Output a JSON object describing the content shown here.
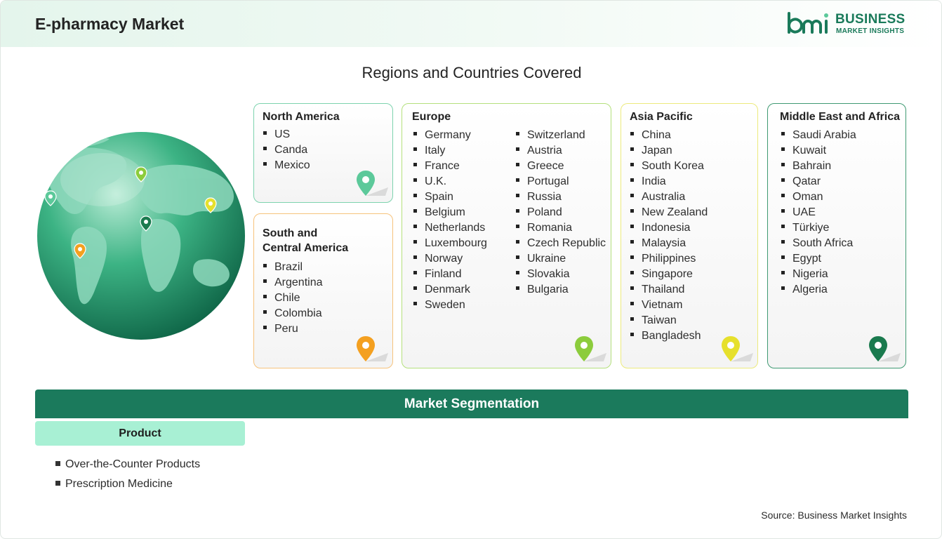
{
  "header": {
    "title": "E-pharmacy Market"
  },
  "logo": {
    "line1": "BUSINESS",
    "line2": "MARKET INSIGHTS",
    "color": "#1a7a5a"
  },
  "section": {
    "title": "Regions and Countries Covered"
  },
  "regions": {
    "north_america": {
      "title": "North America",
      "countries": [
        "US",
        "Canda",
        "Mexico"
      ],
      "color": "#5cc99a"
    },
    "south_central_america": {
      "title_line1": "South and",
      "title_line2": "Central America",
      "countries": [
        "Brazil",
        "Argentina",
        "Chile",
        "Colombia",
        "Peru"
      ],
      "color": "#f4a020"
    },
    "europe": {
      "title": "Europe",
      "countries_col1": [
        "Germany",
        "Italy",
        "France",
        "U.K.",
        "Spain",
        "Belgium",
        "Netherlands",
        "Luxembourg",
        "Norway",
        "Finland",
        "Denmark",
        "Sweden"
      ],
      "countries_col2": [
        "Switzerland",
        "Austria",
        "Greece",
        "Portugal",
        "Russia",
        "Poland",
        "Romania",
        "Czech Republic",
        "Ukraine",
        "Slovakia",
        "Bulgaria"
      ],
      "color": "#8ccc3c"
    },
    "asia_pacific": {
      "title": "Asia Pacific",
      "countries": [
        "China",
        "Japan",
        "South Korea",
        "India",
        "Australia",
        "New Zealand",
        "Indonesia",
        "Malaysia",
        "Philippines",
        "Singapore",
        "Thailand",
        "Vietnam",
        "Taiwan",
        "Bangladesh"
      ],
      "color": "#e6e02c"
    },
    "middle_east_africa": {
      "title": "Middle East and Africa",
      "countries": [
        "Saudi Arabia",
        "Kuwait",
        "Bahrain",
        "Qatar",
        "Oman",
        "UAE",
        "Türkiye",
        "South Africa",
        "Egypt",
        "Nigeria",
        "Algeria"
      ],
      "color": "#1a7a4e"
    }
  },
  "segmentation": {
    "title": "Market Segmentation",
    "product": {
      "label": "Product",
      "items": [
        "Over-the-Counter Products",
        "Prescription Medicine"
      ]
    }
  },
  "source": "Source: Business Market Insights",
  "icons": [
    "map-pin-icon",
    "globe-icon",
    "bmi-logo-icon"
  ]
}
